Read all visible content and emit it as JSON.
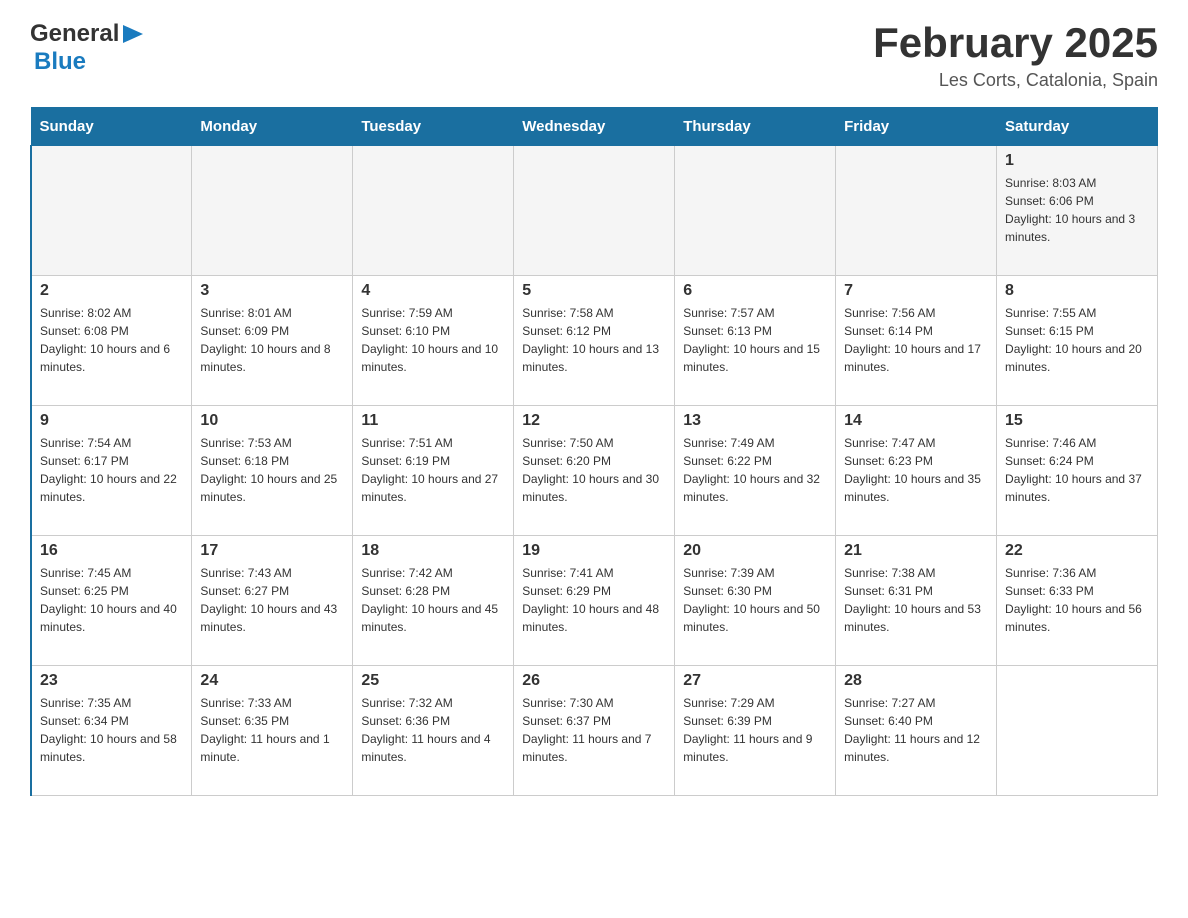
{
  "logo": {
    "text1": "General",
    "text2": "Blue"
  },
  "title": "February 2025",
  "subtitle": "Les Corts, Catalonia, Spain",
  "weekdays": [
    "Sunday",
    "Monday",
    "Tuesday",
    "Wednesday",
    "Thursday",
    "Friday",
    "Saturday"
  ],
  "weeks": [
    [
      {
        "day": "",
        "info": ""
      },
      {
        "day": "",
        "info": ""
      },
      {
        "day": "",
        "info": ""
      },
      {
        "day": "",
        "info": ""
      },
      {
        "day": "",
        "info": ""
      },
      {
        "day": "",
        "info": ""
      },
      {
        "day": "1",
        "info": "Sunrise: 8:03 AM\nSunset: 6:06 PM\nDaylight: 10 hours and 3 minutes."
      }
    ],
    [
      {
        "day": "2",
        "info": "Sunrise: 8:02 AM\nSunset: 6:08 PM\nDaylight: 10 hours and 6 minutes."
      },
      {
        "day": "3",
        "info": "Sunrise: 8:01 AM\nSunset: 6:09 PM\nDaylight: 10 hours and 8 minutes."
      },
      {
        "day": "4",
        "info": "Sunrise: 7:59 AM\nSunset: 6:10 PM\nDaylight: 10 hours and 10 minutes."
      },
      {
        "day": "5",
        "info": "Sunrise: 7:58 AM\nSunset: 6:12 PM\nDaylight: 10 hours and 13 minutes."
      },
      {
        "day": "6",
        "info": "Sunrise: 7:57 AM\nSunset: 6:13 PM\nDaylight: 10 hours and 15 minutes."
      },
      {
        "day": "7",
        "info": "Sunrise: 7:56 AM\nSunset: 6:14 PM\nDaylight: 10 hours and 17 minutes."
      },
      {
        "day": "8",
        "info": "Sunrise: 7:55 AM\nSunset: 6:15 PM\nDaylight: 10 hours and 20 minutes."
      }
    ],
    [
      {
        "day": "9",
        "info": "Sunrise: 7:54 AM\nSunset: 6:17 PM\nDaylight: 10 hours and 22 minutes."
      },
      {
        "day": "10",
        "info": "Sunrise: 7:53 AM\nSunset: 6:18 PM\nDaylight: 10 hours and 25 minutes."
      },
      {
        "day": "11",
        "info": "Sunrise: 7:51 AM\nSunset: 6:19 PM\nDaylight: 10 hours and 27 minutes."
      },
      {
        "day": "12",
        "info": "Sunrise: 7:50 AM\nSunset: 6:20 PM\nDaylight: 10 hours and 30 minutes."
      },
      {
        "day": "13",
        "info": "Sunrise: 7:49 AM\nSunset: 6:22 PM\nDaylight: 10 hours and 32 minutes."
      },
      {
        "day": "14",
        "info": "Sunrise: 7:47 AM\nSunset: 6:23 PM\nDaylight: 10 hours and 35 minutes."
      },
      {
        "day": "15",
        "info": "Sunrise: 7:46 AM\nSunset: 6:24 PM\nDaylight: 10 hours and 37 minutes."
      }
    ],
    [
      {
        "day": "16",
        "info": "Sunrise: 7:45 AM\nSunset: 6:25 PM\nDaylight: 10 hours and 40 minutes."
      },
      {
        "day": "17",
        "info": "Sunrise: 7:43 AM\nSunset: 6:27 PM\nDaylight: 10 hours and 43 minutes."
      },
      {
        "day": "18",
        "info": "Sunrise: 7:42 AM\nSunset: 6:28 PM\nDaylight: 10 hours and 45 minutes."
      },
      {
        "day": "19",
        "info": "Sunrise: 7:41 AM\nSunset: 6:29 PM\nDaylight: 10 hours and 48 minutes."
      },
      {
        "day": "20",
        "info": "Sunrise: 7:39 AM\nSunset: 6:30 PM\nDaylight: 10 hours and 50 minutes."
      },
      {
        "day": "21",
        "info": "Sunrise: 7:38 AM\nSunset: 6:31 PM\nDaylight: 10 hours and 53 minutes."
      },
      {
        "day": "22",
        "info": "Sunrise: 7:36 AM\nSunset: 6:33 PM\nDaylight: 10 hours and 56 minutes."
      }
    ],
    [
      {
        "day": "23",
        "info": "Sunrise: 7:35 AM\nSunset: 6:34 PM\nDaylight: 10 hours and 58 minutes."
      },
      {
        "day": "24",
        "info": "Sunrise: 7:33 AM\nSunset: 6:35 PM\nDaylight: 11 hours and 1 minute."
      },
      {
        "day": "25",
        "info": "Sunrise: 7:32 AM\nSunset: 6:36 PM\nDaylight: 11 hours and 4 minutes."
      },
      {
        "day": "26",
        "info": "Sunrise: 7:30 AM\nSunset: 6:37 PM\nDaylight: 11 hours and 7 minutes."
      },
      {
        "day": "27",
        "info": "Sunrise: 7:29 AM\nSunset: 6:39 PM\nDaylight: 11 hours and 9 minutes."
      },
      {
        "day": "28",
        "info": "Sunrise: 7:27 AM\nSunset: 6:40 PM\nDaylight: 11 hours and 12 minutes."
      },
      {
        "day": "",
        "info": ""
      }
    ]
  ]
}
